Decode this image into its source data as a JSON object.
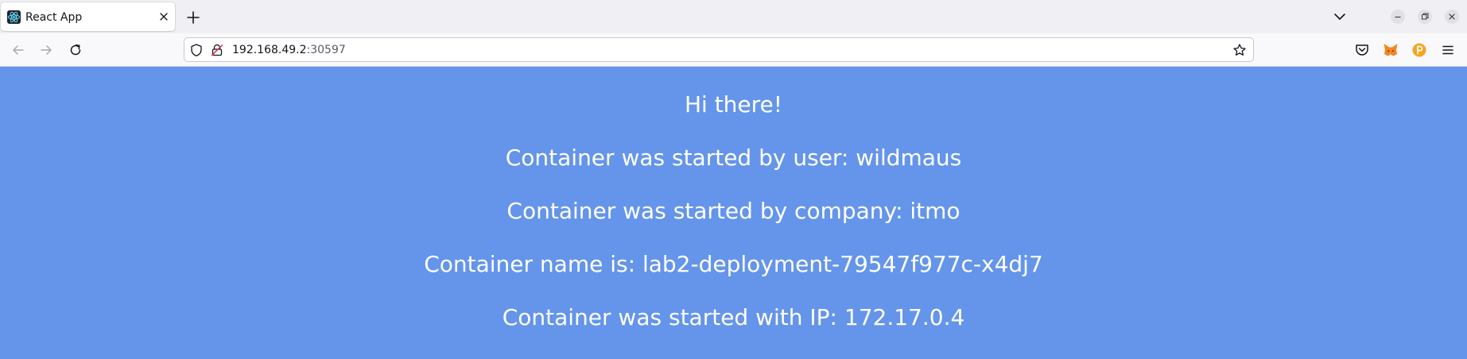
{
  "browser": {
    "tab": {
      "title": "React App",
      "favicon": "react-logo-icon"
    },
    "new_tab_icon": "plus-icon",
    "list_tabs_icon": "chevron-down-icon",
    "window_controls": [
      "minimize-icon",
      "restore-icon",
      "close-icon"
    ],
    "nav": {
      "back_icon": "arrow-left-icon",
      "forward_icon": "arrow-right-icon",
      "reload_icon": "reload-icon"
    },
    "address": {
      "host": "192.168.49.2",
      "port": ":30597"
    },
    "toolbar_icons": [
      "pocket-icon",
      "metamask-fox-icon",
      "p-extension-icon",
      "hamburger-menu-icon"
    ]
  },
  "page": {
    "background_color": "#6595ea",
    "text_color": "#ffffff",
    "lines": [
      "Hi there!",
      "Container was started by user: wildmaus",
      "Container was started by company: itmo",
      "Container name is: lab2-deployment-79547f977c-x4dj7",
      "Container was started with IP: 172.17.0.4"
    ]
  }
}
